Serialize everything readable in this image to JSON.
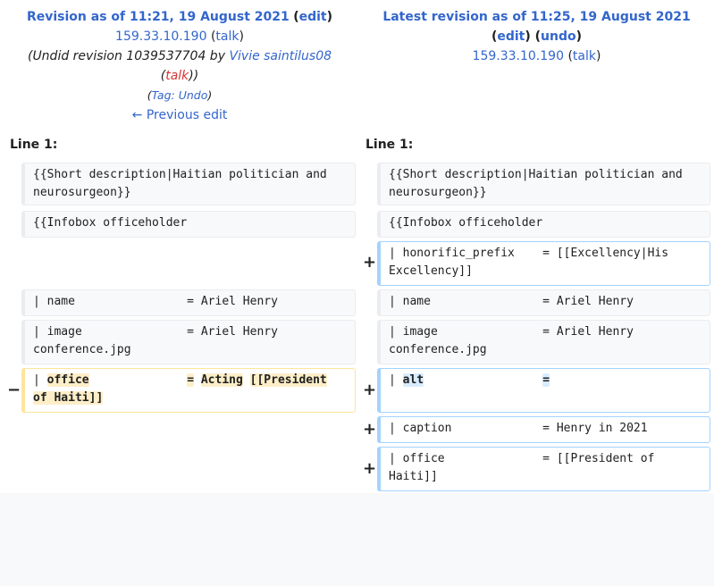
{
  "left_header": {
    "title": "Revision as of 11:21, 19 August 2021",
    "edit_label": "edit",
    "user_link": "159.33.10.190",
    "talk_label": "talk",
    "undid_text": "Undid revision 1039537704 by",
    "undid_user": "Vivie saintilus08",
    "undid_talk": "talk",
    "tag_prefix": "Tag:",
    "tag_name": "Undo",
    "prev_edit": "← Previous edit"
  },
  "right_header": {
    "title": "Latest revision as of 11:25, 19 August 2021",
    "edit_label": "edit",
    "undo_label": "undo",
    "user_link": "159.33.10.190",
    "talk_label": "talk"
  },
  "line_labels": {
    "left": "Line 1:",
    "right": "Line 1:"
  },
  "diff": {
    "ctx_shortdesc": "{{Short description|Haitian politician and neurosurgeon}}",
    "ctx_infobox": "{{Infobox officeholder",
    "add_honorific": "| honorific_prefix    = [[Excellency|His Excellency]]",
    "ctx_name": "| name                = Ariel Henry",
    "ctx_image": "| image               = Ariel Henry conference.jpg",
    "del_office": {
      "pre": "| ",
      "w1": "office",
      "gap1": "              ",
      "w2": "=",
      "gap2": " ",
      "w3": "Acting",
      "gap3": " ",
      "w4": "[[President",
      "gap4": " ",
      "w5": "of Haiti]]"
    },
    "add_alt": {
      "pre": "| ",
      "w1": "alt",
      "gap1": "                 ",
      "w2": "="
    },
    "add_caption": "| caption             = Henry in 2021",
    "add_office": "| office              = [[President of Haiti]]",
    "minus_marker": "−",
    "plus_marker": "+"
  }
}
